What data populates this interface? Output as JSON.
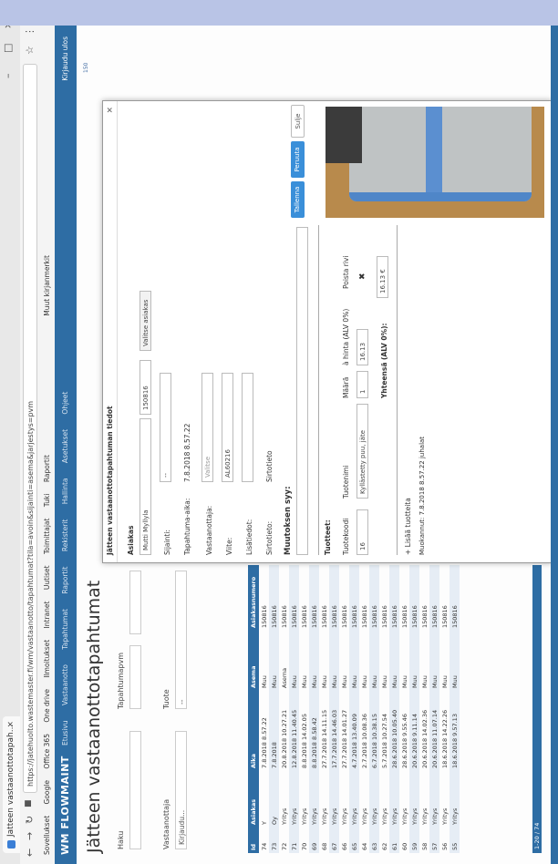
{
  "browser": {
    "tab_title": "Jatteen vastaanottotapah...",
    "tab_close": "×",
    "window_controls": [
      "–",
      "□",
      "×"
    ],
    "url": "https://jatehuolto.wastemaster.fi/wm/vastaanotto/tapahtumat?tila=avoin&sijainti=asema&jarjestys=pvm",
    "bookmarks": [
      "Sovellukset",
      "Google",
      "Office 365",
      "One drive",
      "Ilmoitukset",
      "Intranet",
      "Uutiset",
      "Toimittajat",
      "Tuki",
      "Raportit",
      "Muut kirjanmerkit"
    ]
  },
  "app": {
    "brand": "WM FLOWMAINT",
    "nav": [
      "Etusivu",
      "Vastaanotto",
      "Tapahtumat",
      "Raportit",
      "Rekisterit",
      "Hallinta",
      "Asetukset",
      "Ohjeet"
    ],
    "user": "Kirjaudu ulos"
  },
  "page": {
    "title": "Jätteen vastaanottotapahtumat",
    "filters": {
      "haku_label": "Haku",
      "tapahtumapvm_label": "Tapahtumapvm",
      "vastaanottaja_label": "Vastaanottaja",
      "tuote_label": "Tuote",
      "vastaanottaja_value": "Kirjaudu...",
      "tuote_value": "--"
    },
    "table": {
      "headers": [
        "Id",
        "Asiakas",
        "Aika",
        "Asema",
        "Asiakasnumero"
      ],
      "rows": [
        [
          "74",
          "Y",
          "7.8.2018 8.57.22",
          "Muu",
          "150816"
        ],
        [
          "73",
          "Oy",
          "7.8.2018",
          "Muu",
          "150816"
        ],
        [
          "72",
          "Yritys",
          "20.8.2018 10.27.21",
          "Asema",
          "150816"
        ],
        [
          "71",
          "Yritys",
          "12.8.2018 11.40.45",
          "Muu",
          "150816"
        ],
        [
          "70",
          "Yritys",
          "8.8.2018 14.02.05",
          "Muu",
          "150816"
        ],
        [
          "69",
          "Yritys",
          "8.8.2018 8.58.42",
          "Muu",
          "150816"
        ],
        [
          "68",
          "Yritys",
          "27.7.2018 14.11.15",
          "Muu",
          "150816"
        ],
        [
          "67",
          "Yritys",
          "17.7.2018 14.46.03",
          "Muu",
          "150816"
        ],
        [
          "66",
          "Yritys",
          "27.7.2018 14.01.27",
          "Muu",
          "150816"
        ],
        [
          "65",
          "Yritys",
          "4.7.2018 13.40.09",
          "Muu",
          "150816"
        ],
        [
          "64",
          "Yritys",
          "2.7.2018 10.08.36",
          "Muu",
          "150816"
        ],
        [
          "63",
          "Yritys",
          "6.7.2018 10.38.15",
          "Muu",
          "150816"
        ],
        [
          "62",
          "Yritys",
          "5.7.2018 10.27.54",
          "Muu",
          "150816"
        ],
        [
          "61",
          "Yritys",
          "28.6.2018 10.05.40",
          "Muu",
          "150816"
        ],
        [
          "60",
          "Yritys",
          "28.6.2018 9.55.46",
          "Muu",
          "150816"
        ],
        [
          "59",
          "Yritys",
          "20.6.2018 9.11.14",
          "Muu",
          "150816"
        ],
        [
          "58",
          "Yritys",
          "20.6.2018 14.02.36",
          "Muu",
          "150816"
        ],
        [
          "57",
          "Yritys",
          "20.6.2018 11.07.14",
          "Muu",
          "150816"
        ],
        [
          "56",
          "Yritys",
          "18.6.2018 14.22.26",
          "Muu",
          "150816"
        ],
        [
          "55",
          "Yritys",
          "18.6.2018 9.57.13",
          "Muu",
          "150816"
        ]
      ],
      "footer": "1-20 / 74"
    }
  },
  "modal": {
    "title": "Jätteen vastaanottotapahtuman tiedot",
    "close": "×",
    "asiakas_label": "Asiakas",
    "asiakas_value": "Mutti Myllyla",
    "asiakasnro_value": "150816",
    "valitse_button": "Valitse asiakas",
    "sijainti_label": "Sijainti:",
    "sijainti_value": "--",
    "tapahtuma_aika_label": "Tapahtuma-aika:",
    "tapahtuma_aika_value": "7.8.2018 8.57.22",
    "vastaanottaja_label": "Vastaanottaja:",
    "vastaanottaja_value": "Valitse",
    "viite_label": "Viite:",
    "viite_value": "AL60216",
    "lisatiedot_label": "Lisätiedot:",
    "sirtotieto_label": "Sirtotieto:",
    "sirtotieto_value": "Sirtotieto",
    "muutoksen_syy_label": "Muutoksen syy:",
    "tuotteet_label": "Tuotteet:",
    "col_tuotekoodi": "Tuotekoodi",
    "col_tuotenimi": "Tuotenimi",
    "col_maara": "Määrä",
    "col_hinta": "à hinta (ALV 0%)",
    "col_poista": "Poista rivi",
    "row_tuotekoodi": "16",
    "row_tuotenimi": "Kyllästetty puu, jäte",
    "row_maara": "1",
    "row_hinta": "16.13",
    "row_poista": "✖",
    "yhteensa_label": "Yhteensä (ALV 0%):",
    "yhteensa_value": "16.13 €",
    "lisaa_rivi": "+ Lisää tuotteita",
    "muokannut": "Muokannut: 7.8.2018 8.57.22 juhalat",
    "tallenna_button": "Tallenna",
    "peruuta_button": "Peruuta",
    "sulje_button": "Sulje"
  },
  "colors": {
    "nav": "#2e6da4",
    "button": "#3a8fd9",
    "row_alt": "#e6edf5"
  }
}
